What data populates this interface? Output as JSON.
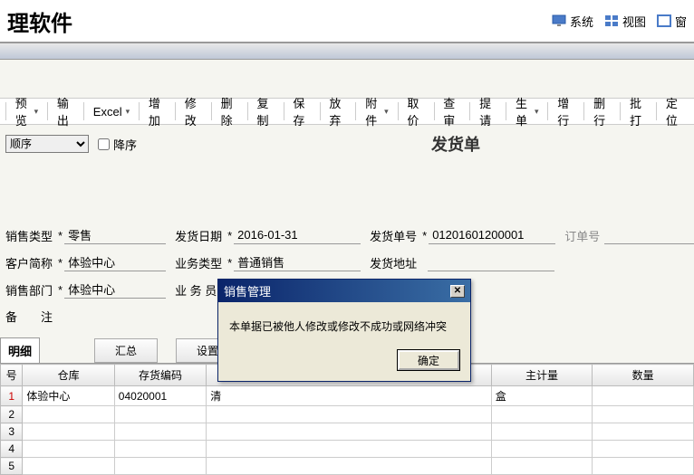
{
  "header": {
    "title": "理软件",
    "menu": [
      {
        "label": "系统"
      },
      {
        "label": "视图"
      },
      {
        "label": "窗"
      }
    ]
  },
  "toolbar": {
    "preview": "预览",
    "export": "输出",
    "excel": "Excel",
    "add": "增加",
    "edit": "修改",
    "delete": "删除",
    "copy": "复制",
    "save": "保存",
    "discard": "放弃",
    "attach": "附件",
    "price": "取价",
    "review": "查审",
    "submit": "提请",
    "generate": "生单",
    "addline": "增行",
    "delline": "删行",
    "batch": "批打",
    "locate": "定位"
  },
  "filter": {
    "sort_label": "顺序",
    "desc_label": "降序"
  },
  "doc_title": "发货单",
  "form": {
    "sale_type_label": "销售类型",
    "sale_type_value": "零售",
    "ship_date_label": "发货日期",
    "ship_date_value": "2016-01-31",
    "ship_no_label": "发货单号",
    "ship_no_value": "01201601200001",
    "order_no_label": "订单号",
    "cust_label": "客户简称",
    "cust_value": "体验中心",
    "biz_type_label": "业务类型",
    "biz_type_value": "普通销售",
    "ship_addr_label": "发货地址",
    "dept_label": "销售部门",
    "dept_value": "体验中心",
    "staff_label": "业 务 员",
    "remark_label": "备　　注"
  },
  "tabs": {
    "detail": "明细",
    "summary": "汇总",
    "settings": "设置"
  },
  "grid": {
    "headers": {
      "rownum": "号",
      "warehouse": "仓库",
      "code": "存货编码",
      "main_qty": "主计量",
      "qty": "数量"
    },
    "rows": [
      {
        "num": "1",
        "warehouse": "体验中心",
        "code": "04020001",
        "after": "清",
        "main_qty": "盒"
      },
      {
        "num": "2"
      },
      {
        "num": "3"
      },
      {
        "num": "4"
      },
      {
        "num": "5"
      }
    ]
  },
  "dialog": {
    "title": "销售管理",
    "message": "本单据已被他人修改或修改不成功或网络冲突",
    "ok": "确定"
  }
}
